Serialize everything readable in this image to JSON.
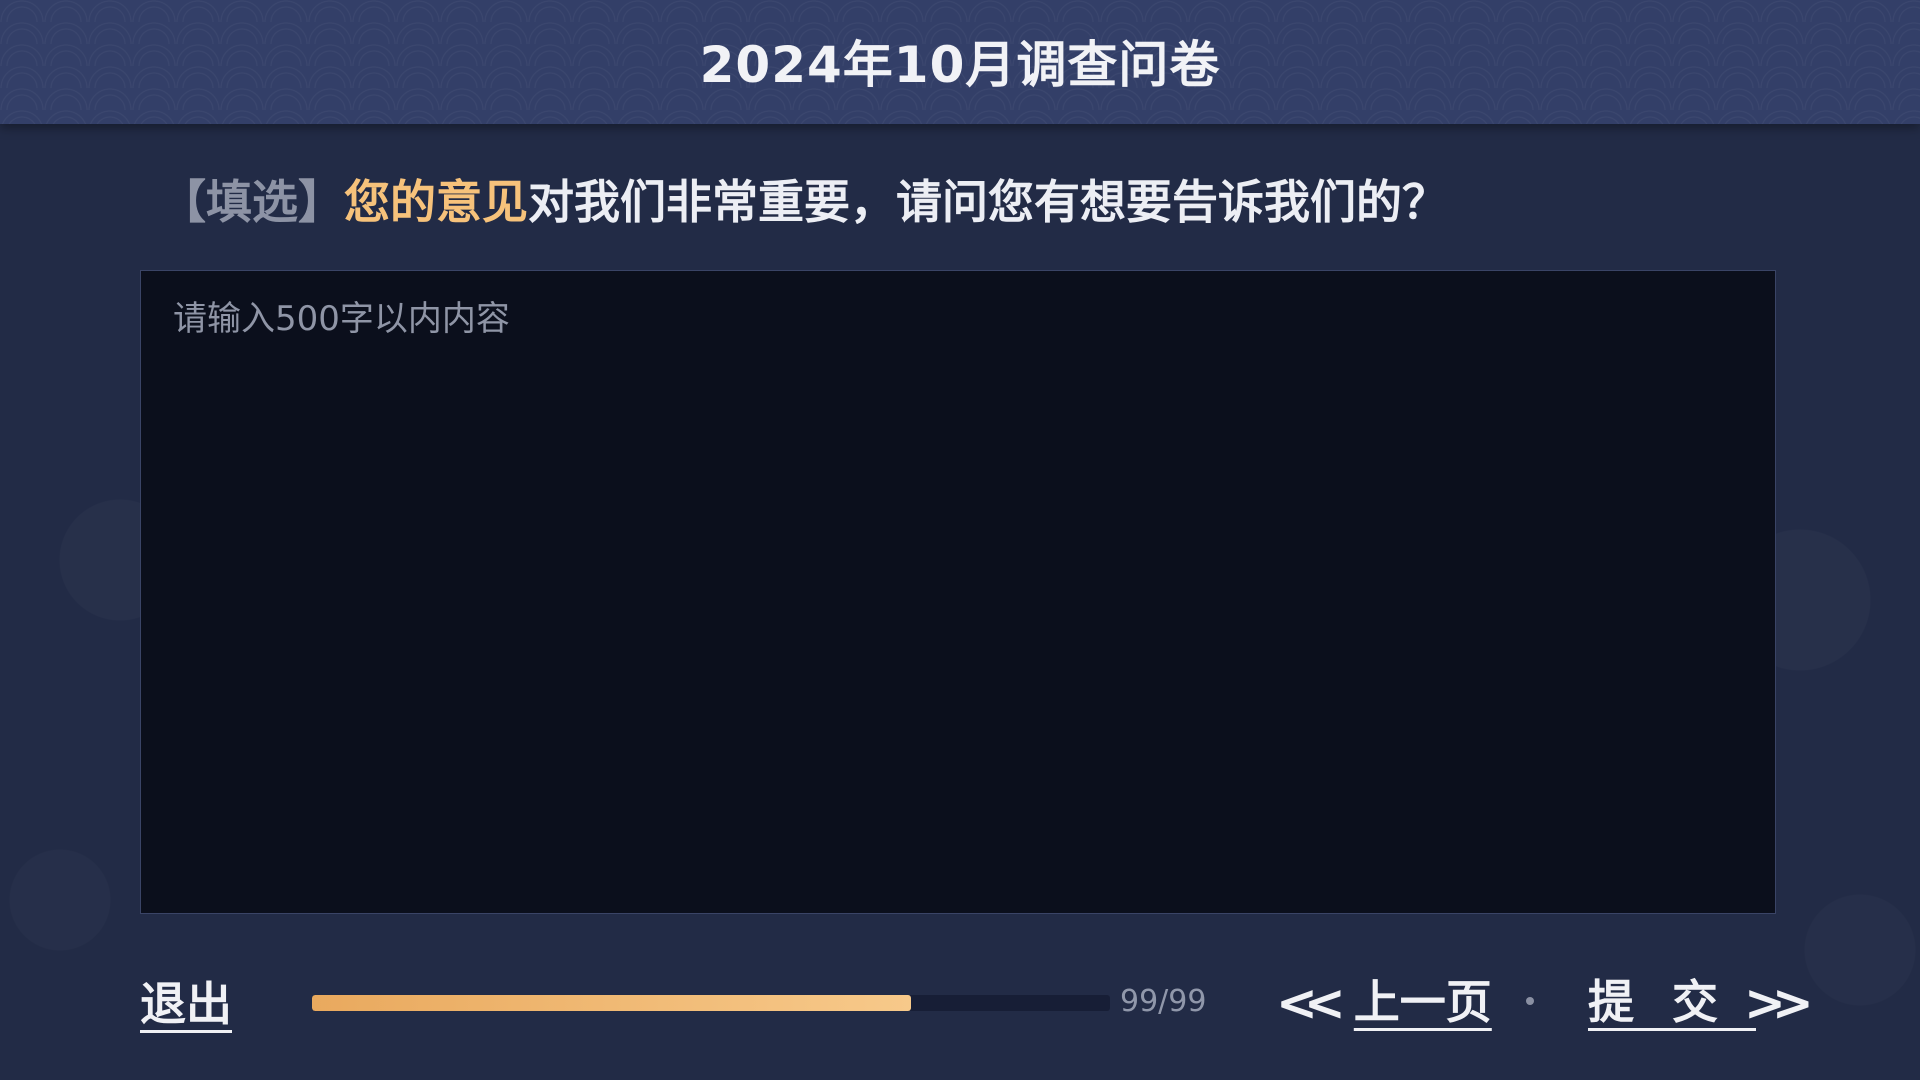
{
  "header": {
    "title": "2024年10月调查问卷"
  },
  "question": {
    "tag": "【填选】",
    "highlight": "您的意见",
    "text": "对我们非常重要，请问您有想要告诉我们的？"
  },
  "answer": {
    "placeholder": "请输入500字以内内容",
    "value": ""
  },
  "footer": {
    "exit_label": "退出",
    "progress": {
      "text": "99/99",
      "fill_percent": 75
    },
    "prev_label": "上一页",
    "prev_arrow": "<<",
    "submit_label": "提交",
    "submit_arrow": ">>"
  },
  "colors": {
    "background": "#222b46",
    "header": "#333f68",
    "accent": "#f6c27b",
    "input_bg": "#0b0f1c"
  }
}
